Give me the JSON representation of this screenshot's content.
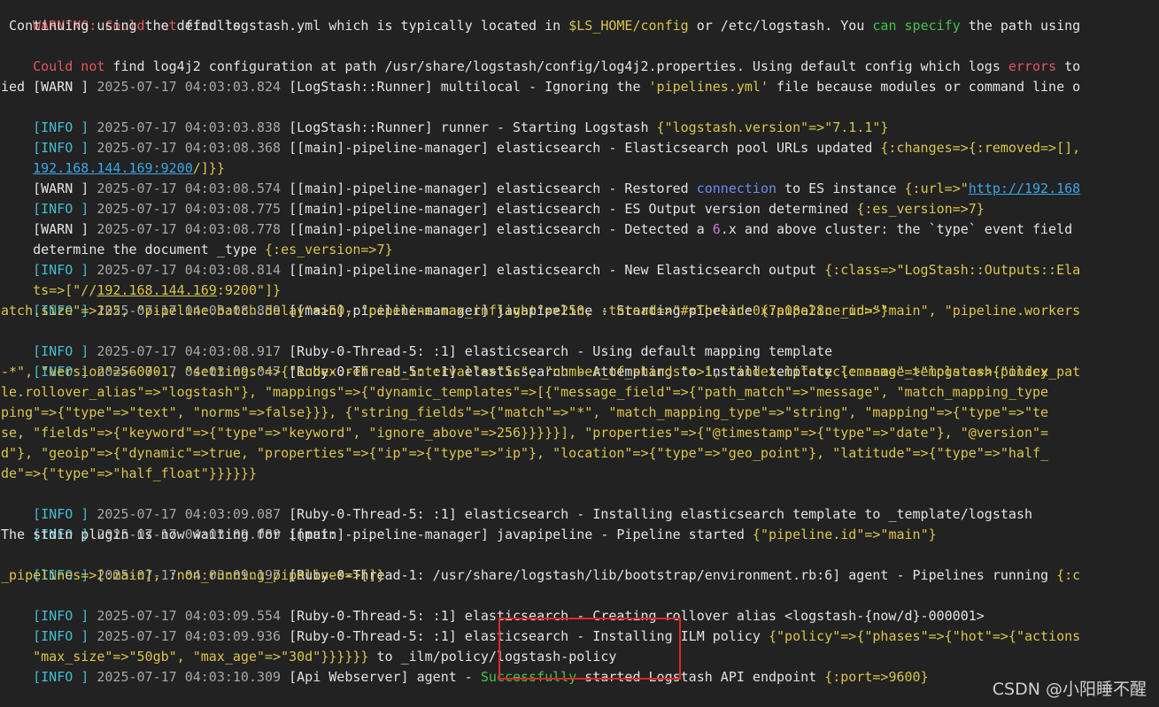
{
  "terminal": {
    "l1": {
      "p1": "WARNING: ",
      "p2": "Could not",
      "p3": " find logstash.yml which is typically located in ",
      "p4": "$LS_HOME/config",
      "p5": " or /etc/logstash. You ",
      "p6": "can specify",
      "p7": " the path using"
    },
    "l2": " Continuing using the defaults",
    "l3": {
      "p1": "Could not",
      "p2": " find log4j2 configuration at path /usr/share/logstash/config/log4j2.properties. Using default config which logs ",
      "p3": "errors",
      "p4": " to"
    },
    "l4": {
      "level": "[WARN ]",
      "ts": " 2025-07-17 04:03:03.824 ",
      "body": "[LogStash::Runner] multilocal - Ignoring the ",
      "str": "'pipelines.yml'",
      "rest": " file because modules or command line o"
    },
    "l5": "ied",
    "l6": {
      "level": "[INFO ]",
      "ts": " 2025-07-17 04:03:03.838 ",
      "body": "[LogStash::Runner] runner - Starting Logstash ",
      "obj": "{\"logstash.version\"=>\"7.1.1\"}"
    },
    "l7": {
      "level": "[INFO ]",
      "ts": " 2025-07-17 04:03:08.368 ",
      "body": "[[main]-pipeline-manager] elasticsearch - Elasticsearch pool URLs updated ",
      "obj": "{:changes=>{:removed=>[],"
    },
    "l8": {
      "ip": "192.168.144.169:9200",
      "rest": "/]}}"
    },
    "l9": {
      "level": "[WARN ]",
      "ts": " 2025-07-17 04:03:08.574 ",
      "body": "[[main]-pipeline-manager] elasticsearch - Restored ",
      "kw": "connection",
      "mid": " to ES instance ",
      "obj": "{:url=>\"",
      "url": "http://192.168"
    },
    "l10": {
      "level": "[INFO ]",
      "ts": " 2025-07-17 04:03:08.775 ",
      "body": "[[main]-pipeline-manager] elasticsearch - ES Output version determined ",
      "obj": "{:es_version=>7}"
    },
    "l11": {
      "level": "[WARN ]",
      "ts": " 2025-07-17 04:03:08.778 ",
      "body": "[[main]-pipeline-manager] elasticsearch - Detected a ",
      "num": "6",
      "rest": ".x and above cluster: the `type` event field"
    },
    "l12": {
      "body": "determine the document _type ",
      "obj": "{:es_version=>7}"
    },
    "l13": {
      "level": "[INFO ]",
      "ts": " 2025-07-17 04:03:08.814 ",
      "body": "[[main]-pipeline-manager] elasticsearch - New Elasticsearch output ",
      "obj": "{:class=>\"LogStash::Outputs::Ela"
    },
    "l14": {
      "pre": "ts=>[\"//",
      "ip": "192.168.144.169",
      "post": ":9200\"]}"
    },
    "l15": {
      "level": "[INFO ]",
      "ts": " 2025-07-17 04:03:08.859 ",
      "body": "[[main]-pipeline-manager] javapipeline - Starting pipeline ",
      "obj": "{:pipeline_id=>\"main\", \"pipeline.workers"
    },
    "l16": "atch.size\"=>125, \"pipeline.batch.delay\"=>50, \"pipeline.max_inflight\"=>250, :thread=>\"#<Thread:0x7a08a28c run>\"}",
    "l17": {
      "level": "[INFO ]",
      "ts": " 2025-07-17 04:03:08.917 ",
      "body": "[Ruby-0-Thread-5: :1] elasticsearch - Using default mapping template"
    },
    "l18": {
      "level": "[INFO ]",
      "ts": " 2025-07-17 04:03:09.047 ",
      "body": "[Ruby-0-Thread-5: :1] elasticsearch - Attempting to install template ",
      "obj": "{:manage_template=>{\"index_pat"
    },
    "l19": "-*\", \"version\"=>60001, \"settings\"=>{\"index.refresh_interval\"=>\"5s\", \"number_of_shards\"=>1, \"index.lifecycle.name\"=>\"logstash-policy",
    "l20": "le.rollover_alias\"=>\"logstash\"}, \"mappings\"=>{\"dynamic_templates\"=>[{\"message_field\"=>{\"path_match\"=>\"message\", \"match_mapping_type",
    "l21": "ping\"=>{\"type\"=>\"text\", \"norms\"=>false}}}, {\"string_fields\"=>{\"match\"=>\"*\", \"match_mapping_type\"=>\"string\", \"mapping\"=>{\"type\"=>\"te",
    "l22": "se, \"fields\"=>{\"keyword\"=>{\"type\"=>\"keyword\", \"ignore_above\"=>256}}}}}], \"properties\"=>{\"@timestamp\"=>{\"type\"=>\"date\"}, \"@version\"=",
    "l23": "d\"}, \"geoip\"=>{\"dynamic\"=>true, \"properties\"=>{\"ip\"=>{\"type\"=>\"ip\"}, \"location\"=>{\"type\"=>\"geo_point\"}, \"latitude\"=>{\"type\"=>\"half_",
    "l24": "de\"=>{\"type\"=>\"half_float\"}}}}}}",
    "l25": {
      "level": "[INFO ]",
      "ts": " 2025-07-17 04:03:09.087 ",
      "body": "[Ruby-0-Thread-5: :1] elasticsearch - Installing elasticsearch template to _template/logstash"
    },
    "l26": {
      "level": "[INFO ]",
      "ts": " 2025-07-17 04:03:09.089 ",
      "body": "[[main]-pipeline-manager] javapipeline - Pipeline started ",
      "obj": "{\"pipeline.id\"=>\"main\"}"
    },
    "l27": "The stdin plugin is now waiting for input:",
    "l28": {
      "level": "[INFO ]",
      "ts": " 2025-07-17 04:03:09.197 ",
      "body": "[Ruby-0-Thread-1: /usr/share/logstash/lib/bootstrap/environment.rb:6] agent - Pipelines running ",
      "obj": "{:c"
    },
    "l29": "_pipelines=>[:main], :non_running_pipelines=>[]}",
    "l30": {
      "level": "[INFO ]",
      "ts": " 2025-07-17 04:03:09.554 ",
      "body": "[Ruby-0-Thread-5: :1] elasticsearch - Creating rollover alias <logstash-{now/d}-000001>"
    },
    "l31": {
      "level": "[INFO ]",
      "ts": " 2025-07-17 04:03:09.936 ",
      "body": "[Ruby-0-Thread-5: :1] elasticsearch - Installing ILM policy ",
      "obj": "{\"policy\"=>{\"phases\"=>{\"hot\"=>{\"actions"
    },
    "l32": {
      "obj": "\"max_size\"=>\"50gb\", \"max_age\"=>\"30d\"}}}}}}",
      "rest": " to _ilm/policy/logstash-policy"
    },
    "l33": {
      "level": "[INFO ]",
      "ts": " 2025-07-17 04:03:10.309 ",
      "body": "[Api Webserver] agent - ",
      "ok": "Successfully",
      "rest": " started Logstash API endpoint ",
      "obj": "{:port=>9600}"
    }
  },
  "watermark": "CSDN @小阳睡不醒",
  "colors": {
    "background": "#222222",
    "highlight_box": "#e02626",
    "error_red": "#e0565f",
    "success_green": "#41c44c",
    "string_yellow": "#d9c54b",
    "info_cyan": "#43bdd3",
    "number_purple": "#c67ad1",
    "keyword_blue": "#6b89f2",
    "link_blue": "#3aa6e8"
  }
}
